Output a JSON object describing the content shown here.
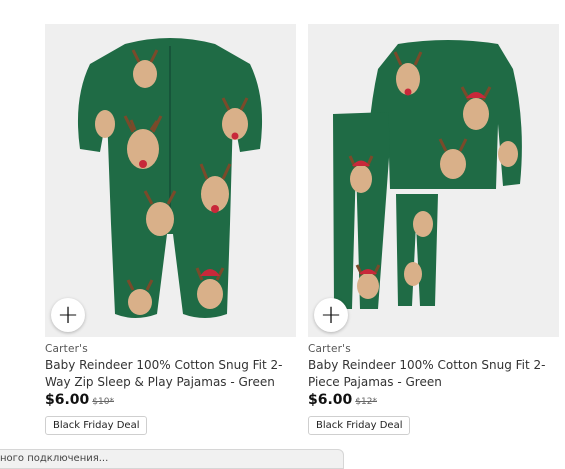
{
  "products": [
    {
      "brand": "Carter's",
      "title": "Baby Reindeer 100% Cotton Snug Fit 2-Way Zip Sleep & Play Pajamas - Green",
      "price": "$6.00",
      "old_price": "$10*",
      "deal_label": "Black Friday Deal",
      "add_label": "+",
      "image": "green reindeer zip sleeper"
    },
    {
      "brand": "Carter's",
      "title": "Baby Reindeer 100% Cotton Snug Fit 2-Piece Pajamas - Green",
      "price": "$6.00",
      "old_price": "$12*",
      "deal_label": "Black Friday Deal",
      "add_label": "+",
      "image": "green reindeer 2-piece pajamas"
    }
  ],
  "status_bar": {
    "text": "ного подключения..."
  },
  "colors": {
    "pajama_green": "#1f6b45",
    "image_bg": "#efefef",
    "reindeer_tan": "#d9b089",
    "antler_brown": "#7a4a2a",
    "hat_red": "#c8283a"
  }
}
